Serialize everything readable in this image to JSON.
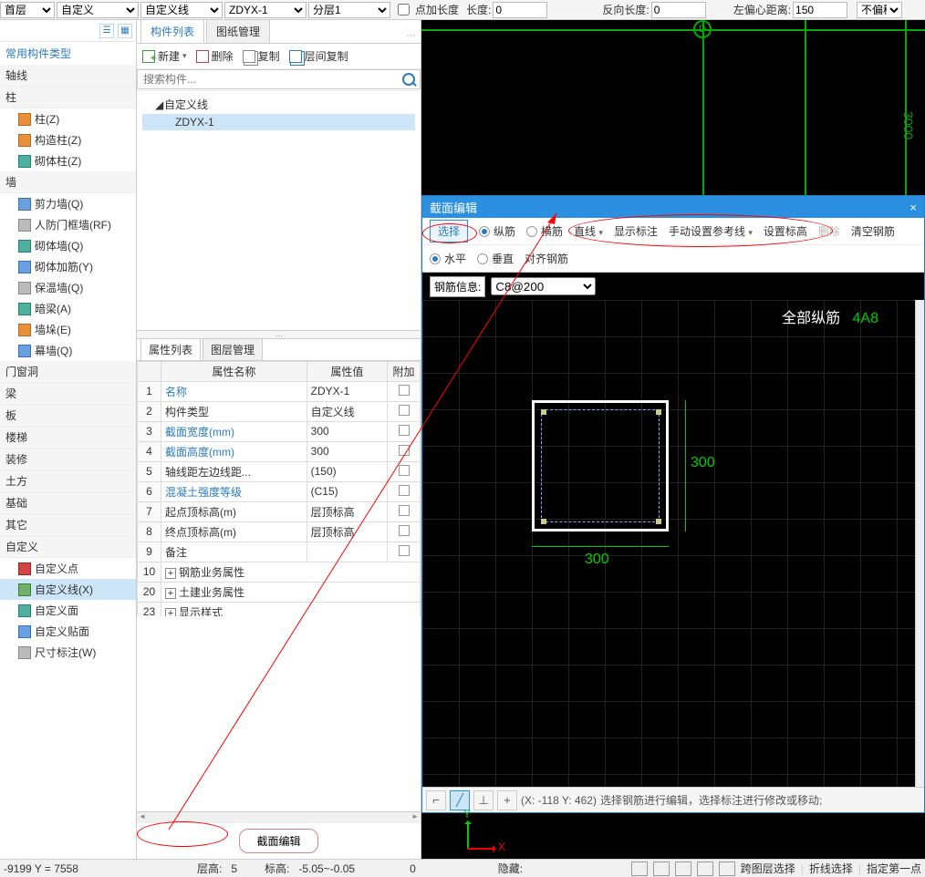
{
  "ribbon": {
    "sel1": "首层",
    "sel2": "自定义",
    "sel3": "自定义线",
    "sel4": "ZDYX-1",
    "sel5": "分层1",
    "chk_point_label": "点加长度",
    "len_label": "长度:",
    "len_val": "0",
    "rev_label": "反向长度:",
    "rev_val": "0",
    "offset_label": "左偏心距离:",
    "offset_val": "150",
    "no_offset": "不偏移"
  },
  "leftnav": {
    "header": "常用构件类型",
    "groups": [
      {
        "title": "轴线",
        "items": []
      },
      {
        "title": "柱",
        "items": [
          {
            "label": "柱(Z)",
            "ic": "orange"
          },
          {
            "label": "构造柱(Z)",
            "ic": "orange"
          },
          {
            "label": "砌体柱(Z)",
            "ic": "teal"
          }
        ]
      },
      {
        "title": "墙",
        "items": [
          {
            "label": "剪力墙(Q)",
            "ic": "blue"
          },
          {
            "label": "人防门框墙(RF)",
            "ic": "gray"
          },
          {
            "label": "砌体墙(Q)",
            "ic": "teal"
          },
          {
            "label": "砌体加筋(Y)",
            "ic": "blue"
          },
          {
            "label": "保温墙(Q)",
            "ic": "gray"
          },
          {
            "label": "暗梁(A)",
            "ic": "teal"
          },
          {
            "label": "墙垛(E)",
            "ic": "orange"
          },
          {
            "label": "幕墙(Q)",
            "ic": "blue"
          }
        ]
      },
      {
        "title": "门窗洞",
        "items": []
      },
      {
        "title": "梁",
        "items": []
      },
      {
        "title": "板",
        "items": []
      },
      {
        "title": "楼梯",
        "items": []
      },
      {
        "title": "装修",
        "items": []
      },
      {
        "title": "土方",
        "items": []
      },
      {
        "title": "基础",
        "items": []
      },
      {
        "title": "其它",
        "items": []
      },
      {
        "title": "自定义",
        "items": [
          {
            "label": "自定义点",
            "ic": "red"
          },
          {
            "label": "自定义线(X)",
            "ic": "green",
            "active": true
          },
          {
            "label": "自定义面",
            "ic": "teal"
          },
          {
            "label": "自定义贴面",
            "ic": "blue"
          },
          {
            "label": "尺寸标注(W)",
            "ic": "gray"
          }
        ]
      }
    ]
  },
  "mid": {
    "tabs": [
      "构件列表",
      "图纸管理"
    ],
    "toolbar": {
      "new": "新建",
      "del": "删除",
      "copy": "复制",
      "lcopy": "层间复制"
    },
    "search_placeholder": "搜索构件...",
    "tree_root": "自定义线",
    "tree_child": "ZDYX-1",
    "prop_tabs": [
      "属性列表",
      "图层管理"
    ],
    "prop_headers": [
      "属性名称",
      "属性值",
      "附加"
    ],
    "props": [
      {
        "n": "1",
        "name": "名称",
        "name_blue": true,
        "val": "ZDYX-1",
        "chk": false
      },
      {
        "n": "2",
        "name": "构件类型",
        "val": "自定义线",
        "chk": false
      },
      {
        "n": "3",
        "name": "截面宽度(mm)",
        "name_blue": true,
        "val": "300",
        "chk": true
      },
      {
        "n": "4",
        "name": "截面高度(mm)",
        "name_blue": true,
        "val": "300",
        "chk": true
      },
      {
        "n": "5",
        "name": "轴线距左边线距...",
        "val": "(150)",
        "chk": true
      },
      {
        "n": "6",
        "name": "混凝土强度等级",
        "name_blue": true,
        "val": "(C15)",
        "chk": true
      },
      {
        "n": "7",
        "name": "起点顶标高(m)",
        "val": "层顶标高",
        "chk": true
      },
      {
        "n": "8",
        "name": "终点顶标高(m)",
        "val": "层顶标高",
        "chk": true
      },
      {
        "n": "9",
        "name": "备注",
        "val": "",
        "chk": true
      },
      {
        "n": "10",
        "name": "钢筋业务属性",
        "exp": true
      },
      {
        "n": "20",
        "name": "土建业务属性",
        "exp": true
      },
      {
        "n": "23",
        "name": "显示样式",
        "exp": true
      }
    ],
    "bottom_button": "截面编辑"
  },
  "section_editor": {
    "title": "截面编辑",
    "close": "×",
    "row1": {
      "select": "选择",
      "r_long": "纵筋",
      "r_trans": "横筋",
      "line": "直线",
      "show_dim": "显示标注",
      "manual_ref": "手动设置参考线",
      "set_elev": "设置标高",
      "del": "删除",
      "clear": "清空钢筋"
    },
    "row2": {
      "horiz": "水平",
      "vert": "垂直",
      "align": "对齐钢筋"
    },
    "info_label": "钢筋信息:",
    "info_value": "C8@200",
    "canvas": {
      "title_white": "全部纵筋",
      "title_green": "4A8",
      "dim_w": "300",
      "dim_h": "300"
    },
    "status": {
      "coord": "(X: -118 Y: 462)",
      "hint": "选择钢筋进行编辑，选择标注进行修改或移动;"
    }
  },
  "bubble_label": "D",
  "axis": {
    "x": "X",
    "y": "Y"
  },
  "dim_3000": "3000",
  "footer": {
    "coord": "-9199 Y = 7558",
    "floor_label": "层高:",
    "floor_val": "5",
    "elev_label": "标高:",
    "elev_val": "-5.05~-0.05",
    "zero": "0",
    "hidden": "隐藏:",
    "cross_layer": "跨图层选择",
    "poly_sel": "折线选择",
    "pick_first": "指定第一点"
  }
}
